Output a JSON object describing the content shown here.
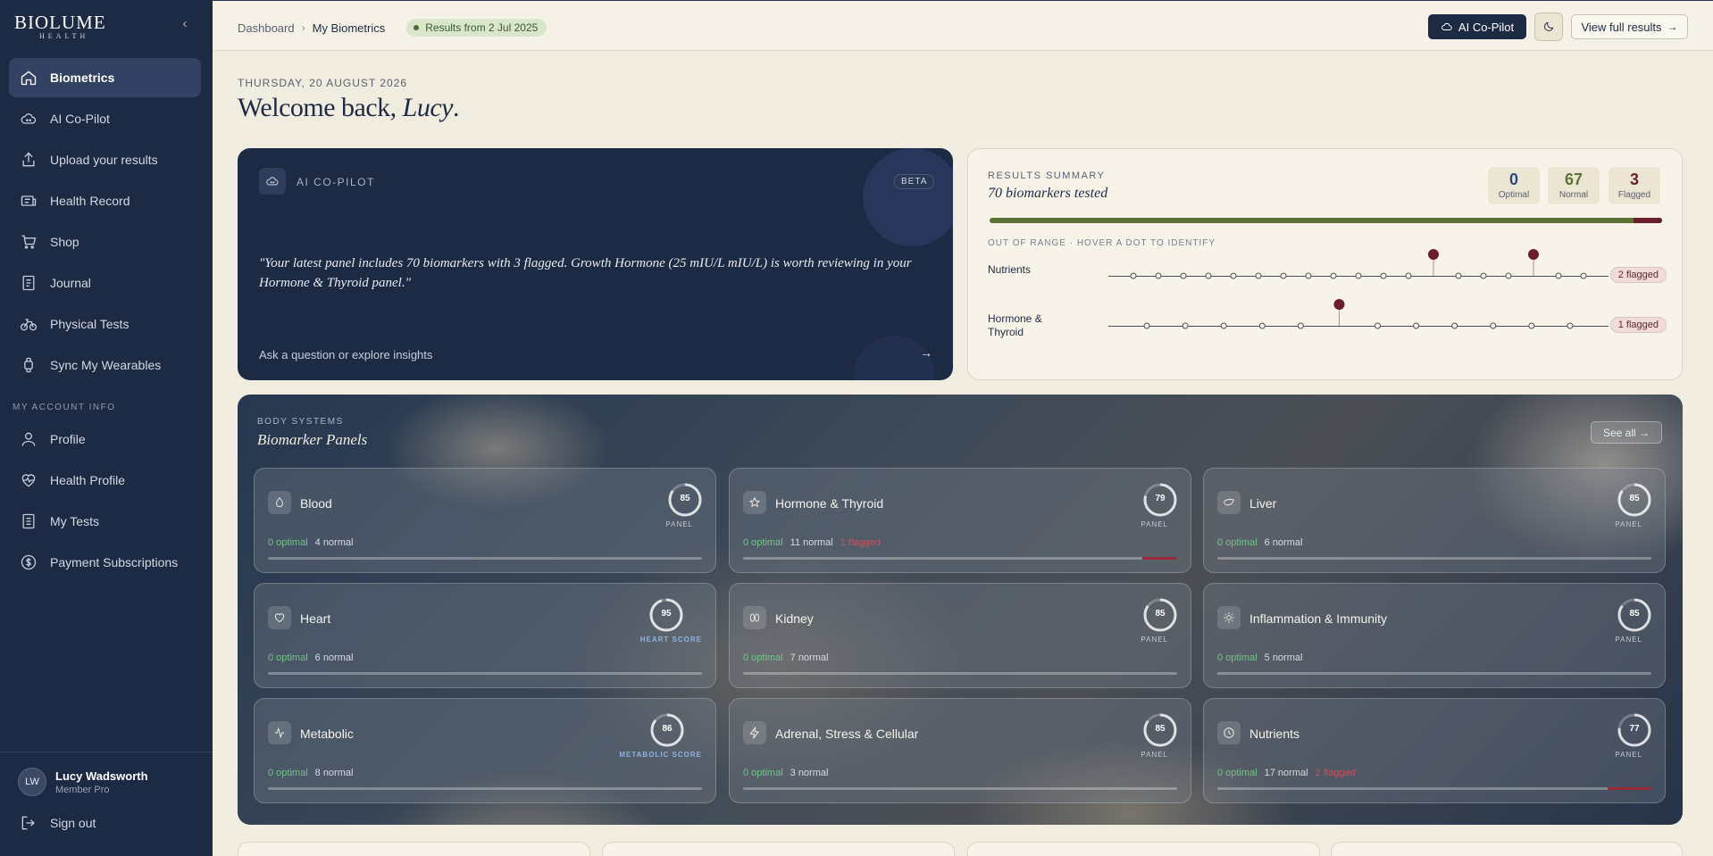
{
  "brand": {
    "name": "BIOLUME",
    "sub": "HEALTH"
  },
  "sidebar": {
    "collapse_icon": "‹",
    "items": [
      {
        "label": "Biometrics",
        "icon": "home-icon",
        "active": true
      },
      {
        "label": "AI Co-Pilot",
        "icon": "cloud-icon"
      },
      {
        "label": "Upload your results",
        "icon": "upload-icon"
      },
      {
        "label": "Health Record",
        "icon": "record-icon"
      },
      {
        "label": "Shop",
        "icon": "cart-icon"
      },
      {
        "label": "Journal",
        "icon": "journal-icon"
      },
      {
        "label": "Physical Tests",
        "icon": "bike-icon"
      },
      {
        "label": "Sync My Wearables",
        "icon": "watch-icon"
      }
    ],
    "account_label": "MY ACCOUNT INFO",
    "account_items": [
      {
        "label": "Profile",
        "icon": "user-icon"
      },
      {
        "label": "Health Profile",
        "icon": "heart-pulse-icon"
      },
      {
        "label": "My Tests",
        "icon": "document-icon"
      },
      {
        "label": "Payment Subscriptions",
        "icon": "dollar-icon"
      }
    ],
    "user": {
      "initials": "LW",
      "name": "Lucy Wadsworth",
      "plan": "Member Pro"
    },
    "signout": "Sign out"
  },
  "topbar": {
    "crumb1": "Dashboard",
    "crumb2": "My Biometrics",
    "results_badge": "Results from 2 Jul 2025",
    "copilot_btn": "AI Co-Pilot",
    "full_results_btn": "View full results",
    "arrow": "→"
  },
  "main": {
    "date": "THURSDAY, 20 AUGUST 2026",
    "welcome_prefix": "Welcome back, ",
    "welcome_name": "Lucy",
    "welcome_suffix": "."
  },
  "copilot_card": {
    "label": "AI CO-PILOT",
    "beta": "BETA",
    "quote": "\"Your latest panel includes 70 biomarkers with 3 flagged. Growth Hormone (25 mIU/L mIU/L) is worth reviewing in your Hormone & Thyroid panel.\"",
    "ask": "Ask a question or explore insights",
    "arrow": "→"
  },
  "summary": {
    "label": "RESULTS SUMMARY",
    "title": "70 biomarkers tested",
    "optimal": {
      "value": "0",
      "label": "Optimal",
      "color": "#2e4a7a"
    },
    "normal": {
      "value": "67",
      "label": "Normal",
      "color": "#5f7235"
    },
    "flagged": {
      "value": "3",
      "label": "Flagged",
      "color": "#6b1f2c"
    },
    "flagged_fraction": 0.043,
    "out_of_range": "OUT OF RANGE · HOVER A DOT TO IDENTIFY",
    "rows": [
      {
        "name": "Nutrients",
        "badge": "2 flagged",
        "total": 19,
        "flagged_index": [
          12,
          16
        ]
      },
      {
        "name": "Hormone & Thyroid",
        "badge": "1 flagged",
        "total": 12,
        "flagged_index": [
          5
        ]
      }
    ]
  },
  "panels": {
    "label": "BODY SYSTEMS",
    "title": "Biomarker Panels",
    "see_all": "See all →",
    "optimal_text": "0 optimal",
    "cards": [
      {
        "name": "Blood",
        "icon": "drop-icon",
        "score": 85,
        "sub": "PANEL",
        "normal": "4 normal",
        "flagged": "",
        "flag_fraction": 0
      },
      {
        "name": "Hormone & Thyroid",
        "icon": "star-icon",
        "score": 79,
        "sub": "PANEL",
        "normal": "11 normal",
        "flagged": "1 flagged",
        "flag_fraction": 0.08
      },
      {
        "name": "Liver",
        "icon": "liver-icon",
        "score": 85,
        "sub": "PANEL",
        "normal": "6 normal",
        "flagged": "",
        "flag_fraction": 0
      },
      {
        "name": "Heart",
        "icon": "heart-icon",
        "score": 95,
        "sub": "HEART SCORE",
        "normal": "6 normal",
        "flagged": "",
        "flag_fraction": 0
      },
      {
        "name": "Kidney",
        "icon": "kidney-icon",
        "score": 85,
        "sub": "PANEL",
        "normal": "7 normal",
        "flagged": "",
        "flag_fraction": 0
      },
      {
        "name": "Inflammation & Immunity",
        "icon": "sun-icon",
        "score": 85,
        "sub": "PANEL",
        "normal": "5 normal",
        "flagged": "",
        "flag_fraction": 0
      },
      {
        "name": "Metabolic",
        "icon": "activity-icon",
        "score": 86,
        "sub": "METABOLIC SCORE",
        "normal": "8 normal",
        "flagged": "",
        "flag_fraction": 0
      },
      {
        "name": "Adrenal, Stress & Cellular",
        "icon": "bolt-icon",
        "score": 85,
        "sub": "PANEL",
        "normal": "3 normal",
        "flagged": "",
        "flag_fraction": 0
      },
      {
        "name": "Nutrients",
        "icon": "clock-icon",
        "score": 77,
        "sub": "PANEL",
        "normal": "17 normal",
        "flagged": "2 flagged",
        "flag_fraction": 0.1
      }
    ]
  }
}
